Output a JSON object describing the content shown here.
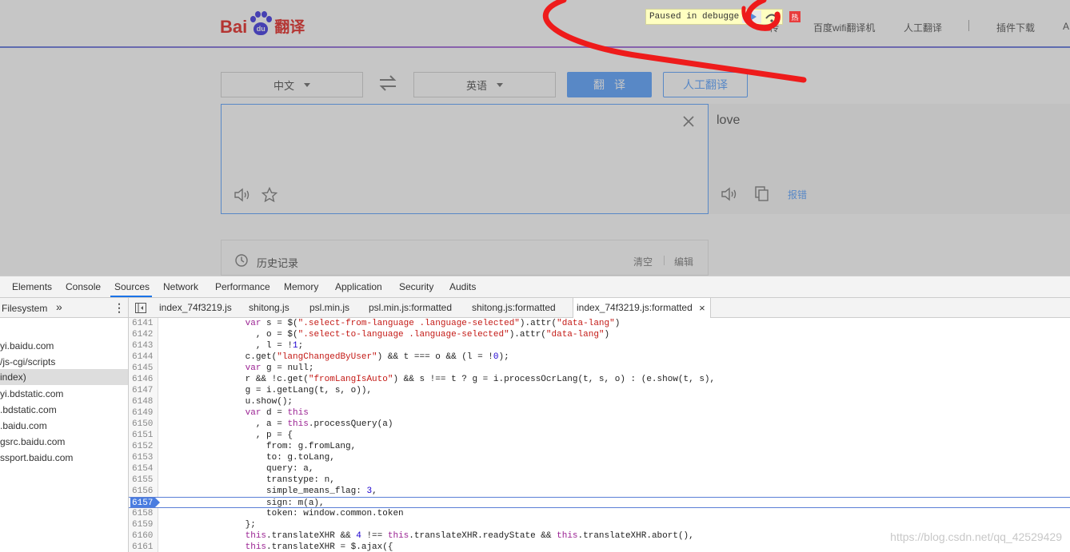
{
  "page": {
    "logo": {
      "bai": "Bai",
      "du": "du",
      "fanyi": "翻译"
    },
    "nav": [
      "传",
      "百度wifi翻译机",
      "人工翻译",
      "插件下载",
      "A"
    ],
    "hot_badge": "热",
    "debugger": {
      "paused_label": "Paused in debugger"
    },
    "source_lang": "中文",
    "target_lang": "英语",
    "translate_btn": "翻译",
    "human_translate_btn": "人工翻译",
    "output_text": "love",
    "report_link": "报错",
    "history": {
      "title": "历史记录",
      "clear": "清空",
      "edit": "编辑"
    }
  },
  "devtools": {
    "tabs": [
      "Elements",
      "Console",
      "Sources",
      "Network",
      "Performance",
      "Memory",
      "Application",
      "Security",
      "Audits"
    ],
    "active_tab": "Sources",
    "navigator": {
      "head": "Filesystem",
      "more": "»",
      "items": [
        "yi.baidu.com",
        "/js-cgi/scripts",
        "index)",
        "yi.bdstatic.com",
        ".bdstatic.com",
        ".baidu.com",
        "gsrc.baidu.com",
        "ssport.baidu.com"
      ]
    },
    "file_tabs": [
      "index_74f3219.js",
      "shitong.js",
      "psl.min.js",
      "psl.min.js:formatted",
      "shitong.js:formatted",
      "index_74f3219.js:formatted"
    ],
    "active_file": "index_74f3219.js:formatted",
    "close_glyph": "×",
    "code_lines": [
      {
        "n": "6141",
        "t": "                var s = $(\".select-from-language .language-selected\").attr(\"data-lang\")"
      },
      {
        "n": "6142",
        "t": "                  , o = $(\".select-to-language .language-selected\").attr(\"data-lang\")"
      },
      {
        "n": "6143",
        "t": "                  , l = !1;"
      },
      {
        "n": "6144",
        "t": "                c.get(\"langChangedByUser\") && t === o && (l = !0);"
      },
      {
        "n": "6145",
        "t": "                var g = null;"
      },
      {
        "n": "6146",
        "t": "                r && !c.get(\"fromLangIsAuto\") && s !== t ? g = i.processOcrLang(t, s, o) : (e.show(t, s),"
      },
      {
        "n": "6147",
        "t": "                g = i.getLang(t, s, o)),"
      },
      {
        "n": "6148",
        "t": "                u.show();"
      },
      {
        "n": "6149",
        "t": "                var d = this"
      },
      {
        "n": "6150",
        "t": "                  , a = this.processQuery(a)"
      },
      {
        "n": "6151",
        "t": "                  , p = {"
      },
      {
        "n": "6152",
        "t": "                    from: g.fromLang,"
      },
      {
        "n": "6153",
        "t": "                    to: g.toLang,"
      },
      {
        "n": "6154",
        "t": "                    query: a,"
      },
      {
        "n": "6155",
        "t": "                    transtype: n,"
      },
      {
        "n": "6156",
        "t": "                    simple_means_flag: 3,"
      },
      {
        "n": "6157",
        "t": "                    sign: m(a),"
      },
      {
        "n": "6158",
        "t": "                    token: window.common.token"
      },
      {
        "n": "6159",
        "t": "                };"
      },
      {
        "n": "6160",
        "t": "                this.translateXHR && 4 !== this.translateXHR.readyState && this.translateXHR.abort(),"
      },
      {
        "n": "6161",
        "t": "                this.translateXHR = $.ajax({"
      }
    ],
    "breakpoint_line": "6157",
    "watermark": "https://blog.csdn.net/qq_42529429"
  }
}
